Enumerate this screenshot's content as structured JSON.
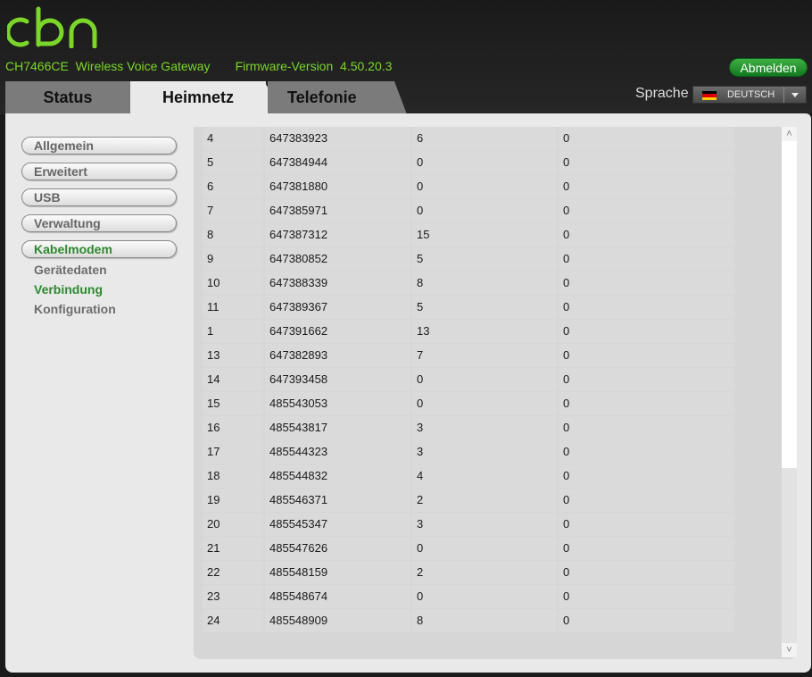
{
  "header": {
    "logo_text": "cbn",
    "model": "CH7466CE",
    "device_name": "Wireless Voice Gateway",
    "firmware_label": "Firmware-Version",
    "firmware_version": "4.50.20.3",
    "logout_label": "Abmelden",
    "brand_color": "#7bd629"
  },
  "tabs": [
    {
      "label": "Status",
      "active": false
    },
    {
      "label": "Heimnetz",
      "active": true
    },
    {
      "label": "Telefonie",
      "active": false
    }
  ],
  "language": {
    "label": "Sprache",
    "selected": "DEUTSCH",
    "flag_icon": "german-flag-icon"
  },
  "sidebar": {
    "items": [
      {
        "label": "Allgemein",
        "active": false
      },
      {
        "label": "Erweitert",
        "active": false
      },
      {
        "label": "USB",
        "active": false
      },
      {
        "label": "Verwaltung",
        "active": false
      },
      {
        "label": "Kabelmodem",
        "active": true
      }
    ],
    "subitems": [
      {
        "label": "Gerätedaten",
        "active": false
      },
      {
        "label": "Verbindung",
        "active": true
      },
      {
        "label": "Konfiguration",
        "active": false
      }
    ]
  },
  "table": {
    "rows": [
      [
        "4",
        "647383923",
        "6",
        "0"
      ],
      [
        "5",
        "647384944",
        "0",
        "0"
      ],
      [
        "6",
        "647381880",
        "0",
        "0"
      ],
      [
        "7",
        "647385971",
        "0",
        "0"
      ],
      [
        "8",
        "647387312",
        "15",
        "0"
      ],
      [
        "9",
        "647380852",
        "5",
        "0"
      ],
      [
        "10",
        "647388339",
        "8",
        "0"
      ],
      [
        "11",
        "647389367",
        "5",
        "0"
      ],
      [
        "1",
        "647391662",
        "13",
        "0"
      ],
      [
        "13",
        "647382893",
        "7",
        "0"
      ],
      [
        "14",
        "647393458",
        "0",
        "0"
      ],
      [
        "15",
        "485543053",
        "0",
        "0"
      ],
      [
        "16",
        "485543817",
        "3",
        "0"
      ],
      [
        "17",
        "485544323",
        "3",
        "0"
      ],
      [
        "18",
        "485544832",
        "4",
        "0"
      ],
      [
        "19",
        "485546371",
        "2",
        "0"
      ],
      [
        "20",
        "485545347",
        "3",
        "0"
      ],
      [
        "21",
        "485547626",
        "0",
        "0"
      ],
      [
        "22",
        "485548159",
        "2",
        "0"
      ],
      [
        "23",
        "485548674",
        "0",
        "0"
      ],
      [
        "24",
        "485548909",
        "8",
        "0"
      ]
    ]
  }
}
